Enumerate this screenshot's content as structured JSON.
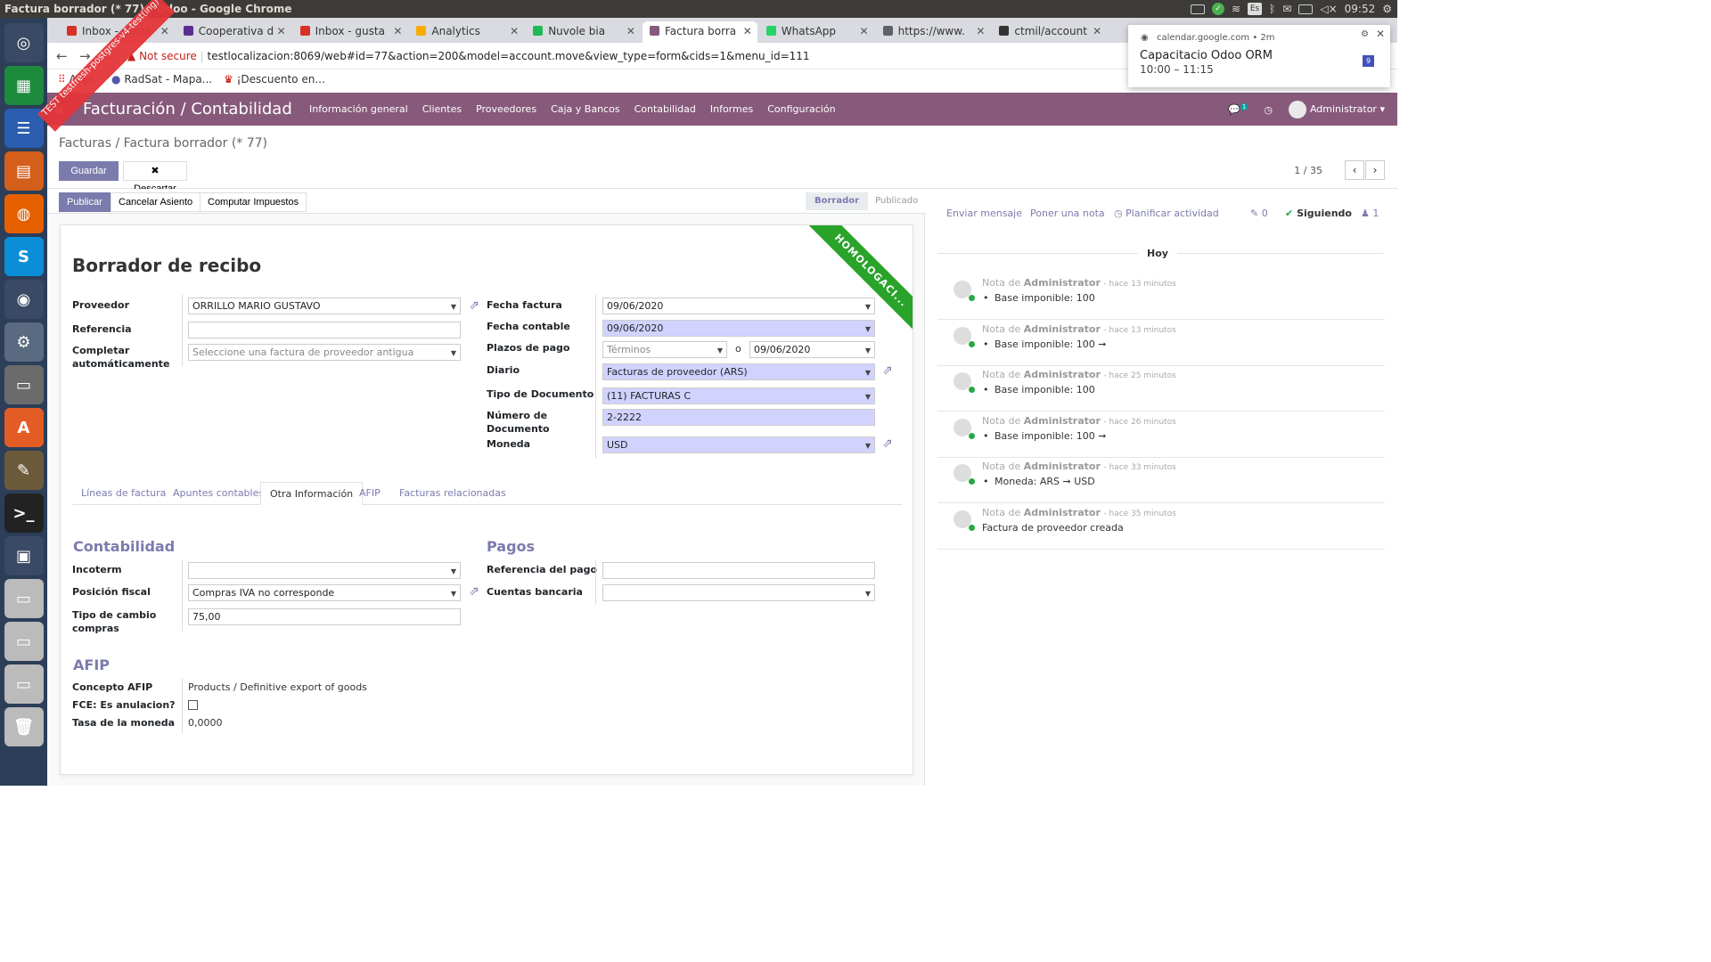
{
  "os": {
    "window_title": "Factura borrador (* 77) - Odoo - Google Chrome",
    "clock": "09:52",
    "lang": "Es"
  },
  "launcher": [
    "ubuntu",
    "calc",
    "writer",
    "impress",
    "firefox",
    "skype",
    "chrome",
    "settings",
    "files",
    "software",
    "editor",
    "terminal",
    "workspaces",
    "disk",
    "disk",
    "disk",
    "trash"
  ],
  "tabs": [
    {
      "label": "Inbox - gusta",
      "fav": "#d93025"
    },
    {
      "label": "Cooperativa d",
      "fav": "#5c2d91"
    },
    {
      "label": "Inbox - gusta",
      "fav": "#d93025"
    },
    {
      "label": "Analytics",
      "fav": "#f9ab00"
    },
    {
      "label": "Nuvole bia",
      "fav": "#1db954"
    },
    {
      "label": "Factura borra",
      "fav": "#875a7b"
    },
    {
      "label": "WhatsApp",
      "fav": "#25d366"
    },
    {
      "label": "https://www.",
      "fav": "#5f6368"
    },
    {
      "label": "ctmil/account",
      "fav": "#333"
    }
  ],
  "omnibox": {
    "security": "Not secure",
    "url": "testlocalizacion:8069/web#id=77&action=200&model=account.move&view_type=form&cids=1&menu_id=111"
  },
  "bookmarks": [
    "Apps",
    "RadSat - Mapa...",
    "¡Descuento en..."
  ],
  "notification": {
    "origin": "calendar.google.com • 2m",
    "title": "Capacitacio Odoo ORM",
    "time": "10:00 – 11:15"
  },
  "app": {
    "brand": "Facturación / Contabilidad",
    "menu": [
      "Información general",
      "Clientes",
      "Proveedores",
      "Caja y Bancos",
      "Contabilidad",
      "Informes",
      "Configuración"
    ],
    "user": "Administrator",
    "msg_count": "1"
  },
  "ribbon": "TEST testfresh-postgres-v4-test(ing)",
  "breadcrumb": {
    "parent": "Facturas",
    "sep": "/",
    "current": "Factura borrador (* 77)"
  },
  "buttons": {
    "save": "Guardar",
    "discard": "Descartar",
    "publish": "Publicar",
    "cancel_entry": "Cancelar Asiento",
    "compute_taxes": "Computar Impuestos"
  },
  "pager": "1 / 35",
  "stages": {
    "draft": "Borrador",
    "posted": "Publicado"
  },
  "homolog": "HOMOLOGACI...",
  "form": {
    "title": "Borrador de recibo",
    "partner_label": "Proveedor",
    "partner": "ORRILLO MARIO GUSTAVO",
    "ref_label": "Referencia",
    "ref": "",
    "autocomplete_label": "Completar automáticamente",
    "autocomplete_ph": "Seleccione una factura de proveedor antigua",
    "invoice_date_label": "Fecha factura",
    "invoice_date": "09/06/2020",
    "acc_date_label": "Fecha contable",
    "acc_date": "09/06/2020",
    "terms_label": "Plazos de pago",
    "terms_ph": "Términos",
    "terms_or": "o",
    "due_date": "09/06/2020",
    "journal_label": "Diario",
    "journal": "Facturas de proveedor (ARS)",
    "doctype_label": "Tipo de Documento",
    "doctype": "(11) FACTURAS C",
    "docnum_label": "Número de Documento",
    "docnum": "2-2222",
    "currency_label": "Moneda",
    "currency": "USD"
  },
  "form_tabs": [
    "Líneas de factura",
    "Apuntes contables",
    "Otra Información",
    "AFIP",
    "Facturas relacionadas"
  ],
  "other": {
    "acc_title": "Contabilidad",
    "incoterm_label": "Incoterm",
    "fpos_label": "Posición fiscal",
    "fpos": "Compras IVA no corresponde",
    "rate_label": "Tipo de cambio compras",
    "rate": "75,00",
    "pay_title": "Pagos",
    "payref_label": "Referencia del pago",
    "bank_label": "Cuentas bancaria",
    "afip_title": "AFIP",
    "concept_label": "Concepto AFIP",
    "concept": "Products / Definitive export of goods",
    "fce_label": "FCE: Es anulacion?",
    "curr_rate_label": "Tasa de la moneda",
    "curr_rate": "0,0000"
  },
  "chatter": {
    "send": "Enviar mensaje",
    "note": "Poner una nota",
    "plan": "Planificar actividad",
    "attach": "0",
    "follow": "Siguiendo",
    "followers": "1",
    "today": "Hoy",
    "messages": [
      {
        "kind": "Nota de",
        "author": "Administrator",
        "time": "- hace 13 minutos",
        "body": "Base imponible: 100",
        "bullet": true
      },
      {
        "kind": "Nota de",
        "author": "Administrator",
        "time": "- hace 13 minutos",
        "body": "Base imponible: 100 ➞",
        "bullet": true
      },
      {
        "kind": "Nota de",
        "author": "Administrator",
        "time": "- hace 25 minutos",
        "body": "Base imponible: 100",
        "bullet": true
      },
      {
        "kind": "Nota de",
        "author": "Administrator",
        "time": "- hace 26 minutos",
        "body": "Base imponible: 100 ➞",
        "bullet": true
      },
      {
        "kind": "Nota de",
        "author": "Administrator",
        "time": "- hace 33 minutos",
        "body": "Moneda: ARS ➞ USD",
        "bullet": true
      },
      {
        "kind": "Nota de",
        "author": "Administrator",
        "time": "- hace 35 minutos",
        "body": "Factura de proveedor creada",
        "bullet": false
      }
    ]
  }
}
